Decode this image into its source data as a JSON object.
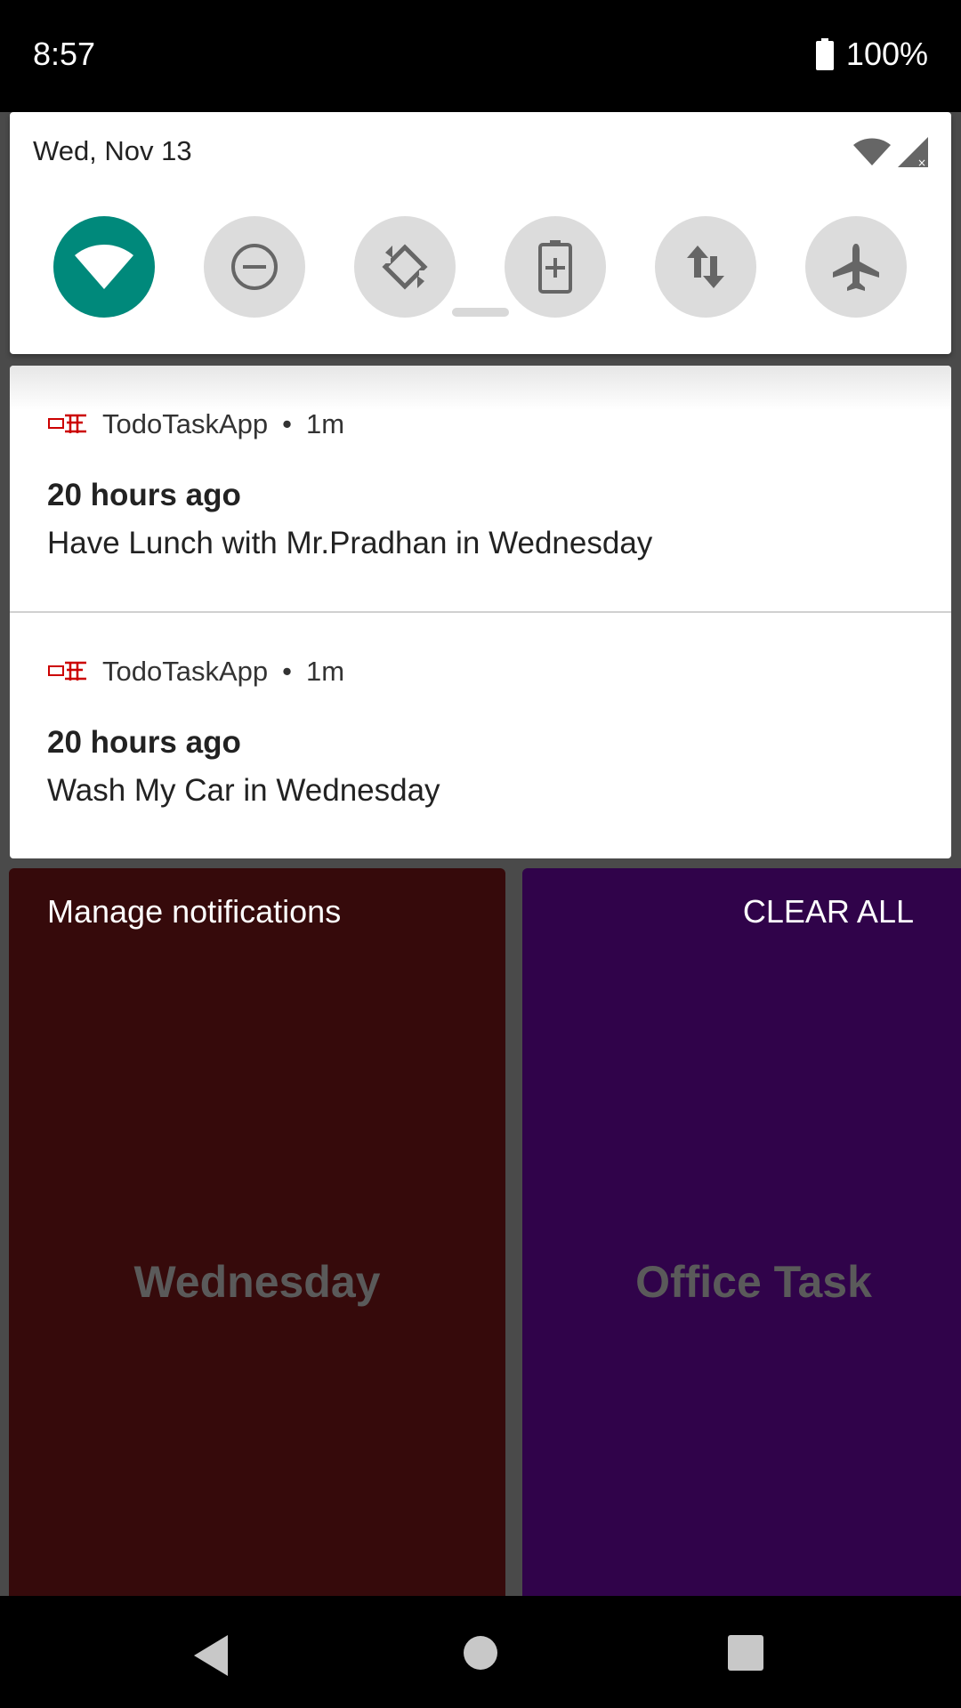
{
  "status_bar": {
    "time": "8:57",
    "battery": "100%"
  },
  "quick_settings": {
    "date": "Wed, Nov 13",
    "tiles": [
      "wifi-icon",
      "do-not-disturb-icon",
      "auto-rotate-icon",
      "battery-saver-icon",
      "mobile-data-icon",
      "airplane-mode-icon"
    ]
  },
  "notifications": [
    {
      "app": "TodoTaskApp",
      "time": "1m",
      "title": "20 hours ago",
      "text": "Have Lunch with Mr.Pradhan in Wednesday"
    },
    {
      "app": "TodoTaskApp",
      "time": "1m",
      "title": "20 hours ago",
      "text": "Wash My Car in Wednesday"
    }
  ],
  "actions": {
    "manage": "Manage notifications",
    "clear_all": "CLEAR ALL"
  },
  "background_tiles": {
    "left": "Wednesday",
    "right": "Office Task"
  },
  "colors": {
    "accent": "#00897b",
    "tile_left": "#360a0b",
    "tile_right": "#30034a"
  }
}
